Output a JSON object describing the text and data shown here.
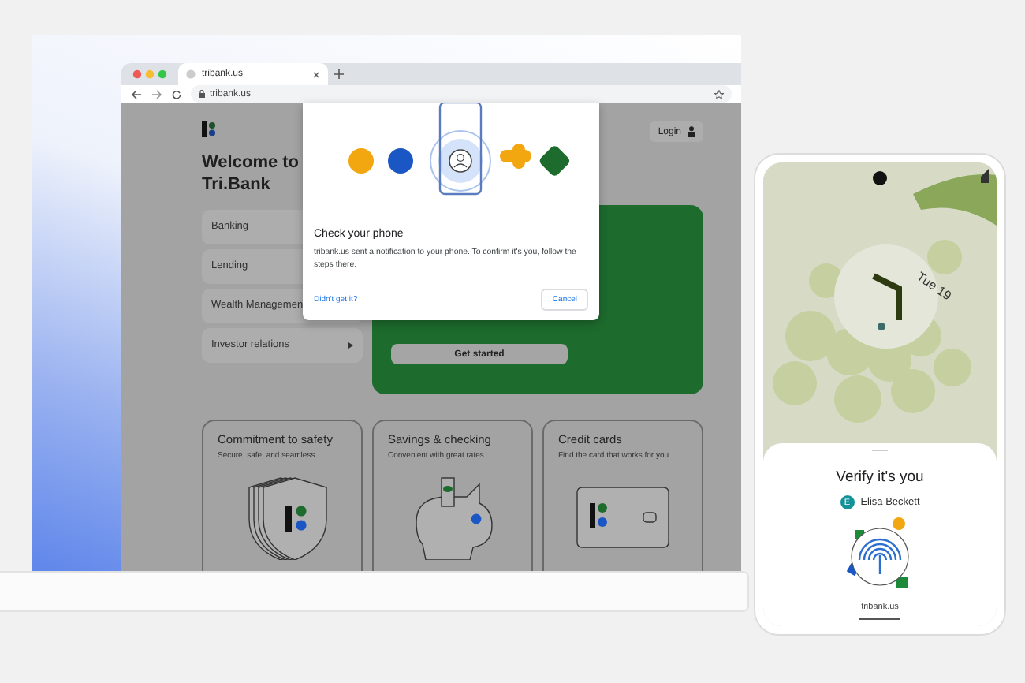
{
  "browser": {
    "tab_title": "tribank.us",
    "url": "tribank.us"
  },
  "site": {
    "login": "Login",
    "headline": "Welcome to Tri.Bank",
    "cta": "Get started",
    "menu": [
      {
        "label": "Banking"
      },
      {
        "label": "Lending"
      },
      {
        "label": "Wealth Managemen"
      },
      {
        "label": "Investor relations",
        "submenu": true
      }
    ],
    "cards": [
      {
        "title": "Commitment to safety",
        "subtitle": "Secure, safe, and seamless",
        "kind": "shield"
      },
      {
        "title": "Savings & checking",
        "subtitle": "Convenient with great rates",
        "kind": "piggy"
      },
      {
        "title": "Credit cards",
        "subtitle": "Find the card that works for you",
        "kind": "card"
      }
    ]
  },
  "dialog": {
    "title": "Check your phone",
    "body": "tribank.us sent a notification to your phone. To confirm it's you, follow the steps there.",
    "link": "Didn't get it?",
    "button": "Cancel"
  },
  "phone": {
    "date": "Tue 19",
    "sheet": {
      "title": "Verify it's you",
      "account": {
        "initial": "E",
        "name": "Elisa Beckett"
      },
      "domain": "tribank.us"
    }
  }
}
